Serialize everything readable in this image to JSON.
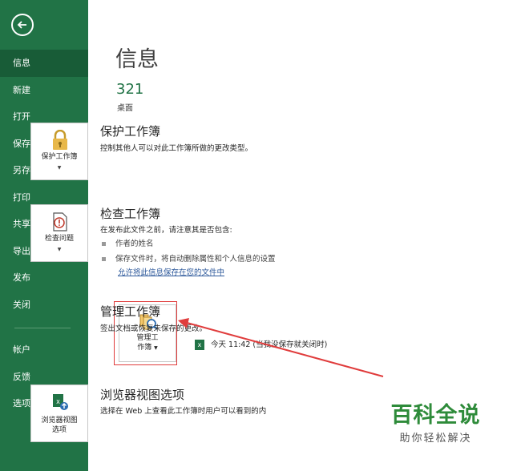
{
  "sidebar": {
    "items": [
      "信息",
      "新建",
      "打开",
      "保存",
      "另存为",
      "打印",
      "共享",
      "导出",
      "发布",
      "关闭"
    ],
    "bottom_items": [
      "帐户",
      "反馈",
      "选项"
    ]
  },
  "main": {
    "title": "信息",
    "file_name": "321",
    "file_location": "桌面",
    "protect": {
      "tile_label": "保护工作簿",
      "title": "保护工作簿",
      "desc": "控制其他人可以对此工作簿所做的更改类型。"
    },
    "inspect": {
      "tile_label": "检查问题",
      "title": "检查工作簿",
      "desc": "在发布此文件之前，请注意其是否包含:",
      "bullets": [
        "作者的姓名",
        "保存文件时，将自动删除属性和个人信息的设置"
      ],
      "link": "允许将此信息保存在您的文件中"
    },
    "manage": {
      "tile_label_1": "管理工",
      "tile_label_2": "作簿",
      "title": "管理工作簿",
      "desc": "签出文档或恢复未保存的更改。",
      "version_text": "今天 11:42 (当我没保存就关闭时)"
    },
    "browser": {
      "tile_label_1": "浏览器视图",
      "tile_label_2": "选项",
      "title": "浏览器视图选项",
      "desc": "选择在 Web 上查看此工作簿时用户可以看到的内"
    }
  },
  "watermark": {
    "title": "百科全说",
    "subtitle": "助你轻松解决"
  },
  "colors": {
    "sidebar": "#217346",
    "sidebar_active": "#185c37",
    "accent_green": "#217346",
    "annotation_red": "#e03c3c"
  }
}
